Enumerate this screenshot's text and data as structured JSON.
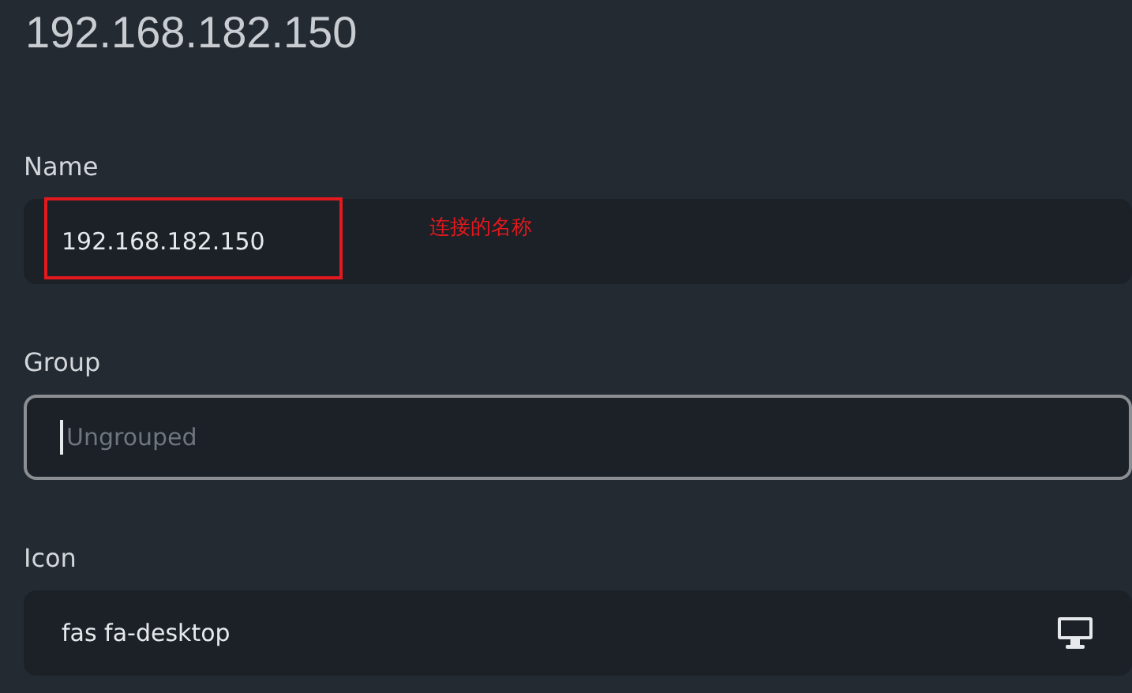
{
  "title": "192.168.182.150",
  "fields": [
    {
      "label": "Name",
      "kind": "text",
      "value": "192.168.182.150",
      "focused": false,
      "highlighted": true,
      "annotation": "连接的名称"
    },
    {
      "label": "Group",
      "kind": "text",
      "placeholder": "Ungrouped",
      "focused": true
    },
    {
      "label": "Icon",
      "kind": "icon",
      "value": "fas fa-desktop",
      "focused": false
    }
  ]
}
